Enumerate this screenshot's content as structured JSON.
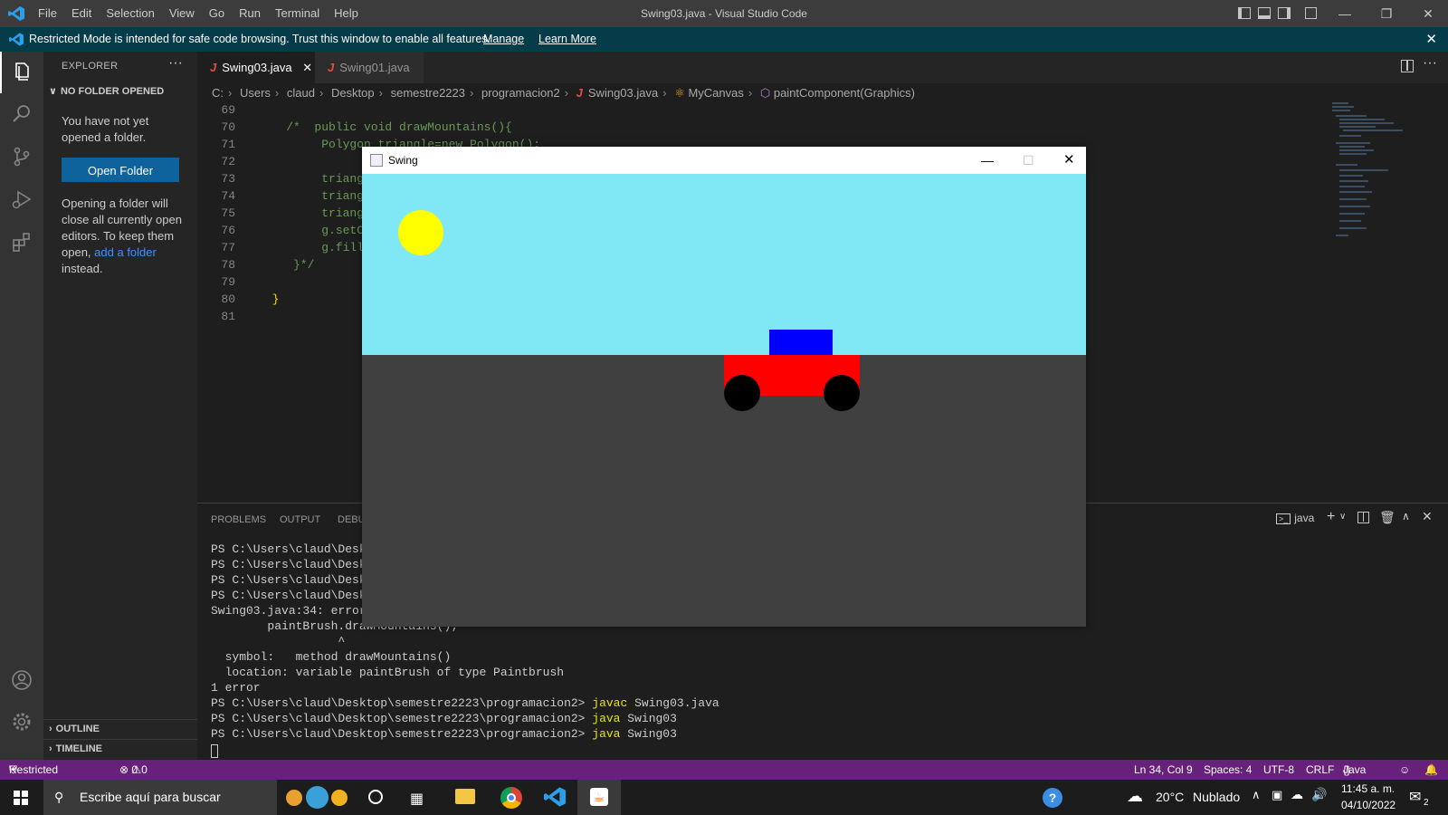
{
  "titlebar": {
    "menu": [
      "File",
      "Edit",
      "Selection",
      "View",
      "Go",
      "Run",
      "Terminal",
      "Help"
    ],
    "window_title": "Swing03.java - Visual Studio Code"
  },
  "banner": {
    "message": "Restricted Mode is intended for safe code browsing. Trust this window to enable all features.",
    "manage": "Manage",
    "learn_more": "Learn More"
  },
  "sidebar": {
    "header": "EXPLORER",
    "section_title": "NO FOLDER OPENED",
    "no_folder_text": "You have not yet opened a folder.",
    "open_folder_button": "Open Folder",
    "info_prefix": "Opening a folder will close all currently open editors. To keep them open,",
    "info_link": "add a folder",
    "info_suffix": "instead.",
    "outline": "OUTLINE",
    "timeline": "TIMELINE"
  },
  "tabs": [
    {
      "label": "Swing03.java",
      "active": true
    },
    {
      "label": "Swing01.java",
      "active": false
    }
  ],
  "breadcrumb": [
    "C:",
    "Users",
    "claud",
    "Desktop",
    "semestre2223",
    "programacion2",
    "Swing03.java",
    "MyCanvas",
    "paintComponent(Graphics)"
  ],
  "code": {
    "line_numbers": [
      "69",
      "70",
      "71",
      "72",
      "73",
      "74",
      "75",
      "76",
      "77",
      "78",
      "79",
      "80",
      "81"
    ],
    "lines": [
      "",
      "    /*  public void drawMountains(){",
      "         Polygon triangle=new Polygon();",
      "",
      "         triangl",
      "         triangl",
      "         triangl",
      "         g.setCo",
      "         g.fillP",
      "     }*/",
      "",
      "  }",
      ""
    ]
  },
  "panel": {
    "tabs": [
      "PROBLEMS",
      "OUTPUT",
      "DEBUG CONSOLE"
    ],
    "terminal_name": "java",
    "lines": [
      {
        "text": "PS C:\\Users\\claud\\Deskt"
      },
      {
        "text": "PS C:\\Users\\claud\\Deskt"
      },
      {
        "text": "PS C:\\Users\\claud\\Deskt"
      },
      {
        "text": "PS C:\\Users\\claud\\Deskt"
      },
      {
        "text": "Swing03.java:34: error:"
      },
      {
        "text": "        paintBrush.drawMountains();"
      },
      {
        "text": "                  ^"
      },
      {
        "text": "  symbol:   method drawMountains()"
      },
      {
        "text": "  location: variable paintBrush of type Paintbrush"
      },
      {
        "text": "1 error"
      },
      {
        "prompt": "PS C:\\Users\\claud\\Desktop\\semestre2223\\programacion2> ",
        "cmd": "javac",
        "arg": " Swing03.java"
      },
      {
        "prompt": "PS C:\\Users\\claud\\Desktop\\semestre2223\\programacion2> ",
        "cmd": "java",
        "arg": " Swing03"
      },
      {
        "prompt": "PS C:\\Users\\claud\\Desktop\\semestre2223\\programacion2> ",
        "cmd": "java",
        "arg": " Swing03"
      }
    ]
  },
  "status": {
    "restricted": "Restricted Mode",
    "errors": "0",
    "warnings": "0",
    "position": "Ln 34, Col 9",
    "spaces": "Spaces: 4",
    "encoding": "UTF-8",
    "eol": "CRLF",
    "language": "Java"
  },
  "taskbar": {
    "search_placeholder": "Escribe aquí para buscar",
    "temperature": "20°C",
    "weather": "Nublado",
    "time": "11:45 a. m.",
    "date": "04/10/2022",
    "notifications": "2"
  },
  "swing": {
    "title": "Swing",
    "colors": {
      "sky": "#80e8f5",
      "ground": "#404040",
      "sun": "#ffff00",
      "car_body": "#ff0000",
      "car_roof": "#0000ff",
      "wheel": "#000000"
    }
  }
}
